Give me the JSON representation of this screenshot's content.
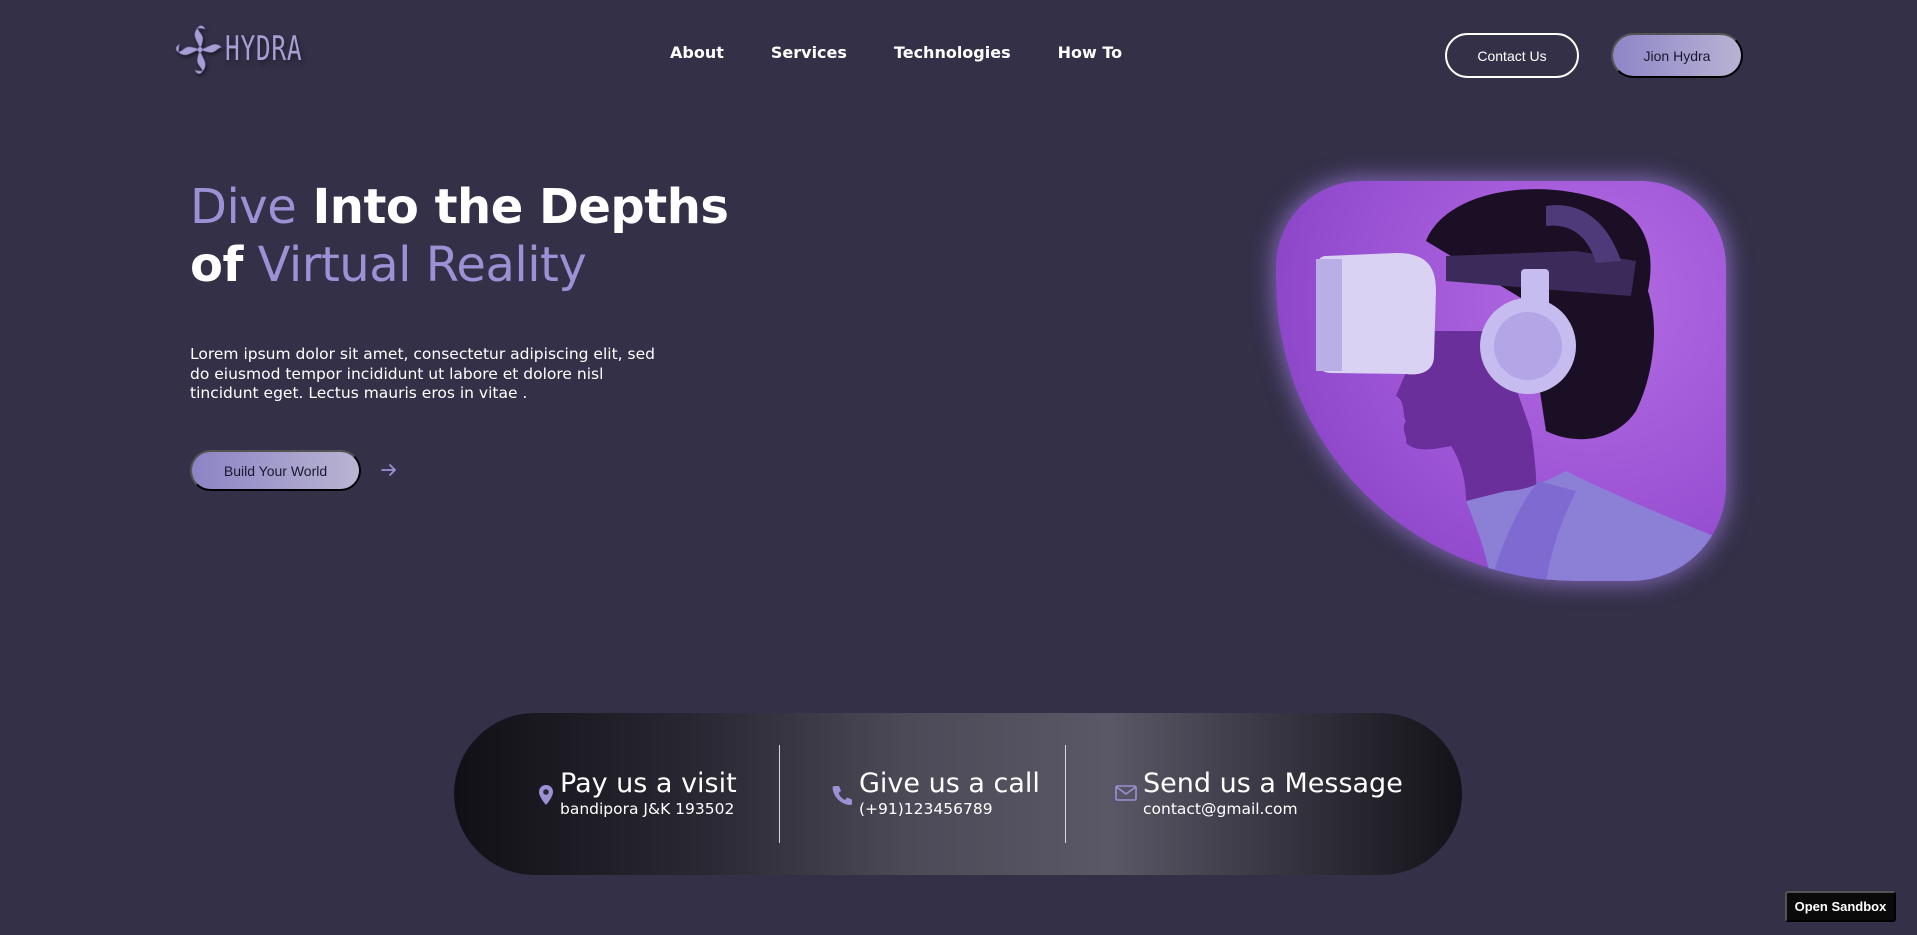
{
  "brand": {
    "logo_text": "HYDRA",
    "logo_icon": "hydra-swirl-icon",
    "accent_color": "#9b91d4",
    "background_color": "#343048"
  },
  "nav": {
    "items": [
      {
        "label": "About"
      },
      {
        "label": "Services"
      },
      {
        "label": "Technologies"
      },
      {
        "label": "How To"
      }
    ]
  },
  "header_actions": {
    "contact_label": "Contact Us",
    "join_label": "Jion Hydra"
  },
  "hero": {
    "title_line1_accent": "Dive",
    "title_line1_rest": " Into the Depths",
    "title_line2_strong": "of",
    "title_line2_accent": " Virtual Reality",
    "description": "Lorem ipsum dolor sit amet, consectetur adipiscing elit, sed do eiusmod tempor incididunt ut labore et dolore nisl tincidunt eget. Lectus mauris eros in vitae .",
    "cta_label": "Build Your World",
    "cta_icon": "arrow-right-icon",
    "image": "person-wearing-vr-headset"
  },
  "contact": {
    "items": [
      {
        "icon": "location-pin-icon",
        "title": "Pay us a visit",
        "detail": "bandipora J&K 193502"
      },
      {
        "icon": "phone-icon",
        "title": "Give us a call",
        "detail": "(+91)123456789"
      },
      {
        "icon": "mail-icon",
        "title": "Send us a Message",
        "detail": "contact@gmail.com"
      }
    ]
  },
  "sandbox": {
    "label": "Open Sandbox"
  }
}
